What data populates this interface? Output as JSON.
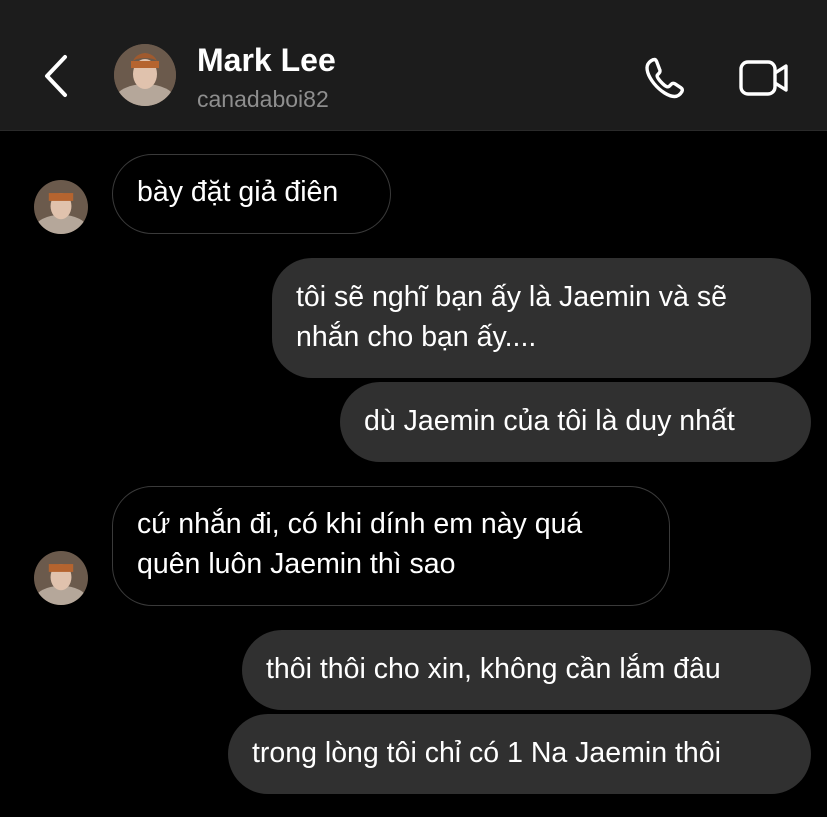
{
  "header": {
    "contact_name": "Mark Lee",
    "username": "canadaboi82",
    "icons": {
      "back": "chevron-left-icon",
      "call": "phone-icon",
      "video": "video-camera-icon"
    }
  },
  "colors": {
    "background": "#000000",
    "header_background": "#1c1c1c",
    "outgoing_bubble": "#303030",
    "incoming_bubble_border": "#3a3a3a",
    "secondary_text": "#8e8e8e"
  },
  "messages": [
    {
      "direction": "incoming",
      "lines": [
        "bày đặt giả điên"
      ]
    },
    {
      "direction": "outgoing",
      "lines": [
        "tôi sẽ nghĩ bạn ấy là Jaemin và sẽ",
        "nhắn cho bạn ấy...."
      ]
    },
    {
      "direction": "outgoing",
      "lines": [
        "dù Jaemin của tôi là duy nhất"
      ]
    },
    {
      "direction": "incoming",
      "lines": [
        "cứ nhắn đi, có khi dính em này quá",
        "quên luôn Jaemin thì sao"
      ]
    },
    {
      "direction": "outgoing",
      "lines": [
        "thôi thôi cho xin, không cần lắm đâu"
      ]
    },
    {
      "direction": "outgoing",
      "lines": [
        "trong lòng tôi chỉ có 1 Na Jaemin thôi"
      ]
    }
  ]
}
